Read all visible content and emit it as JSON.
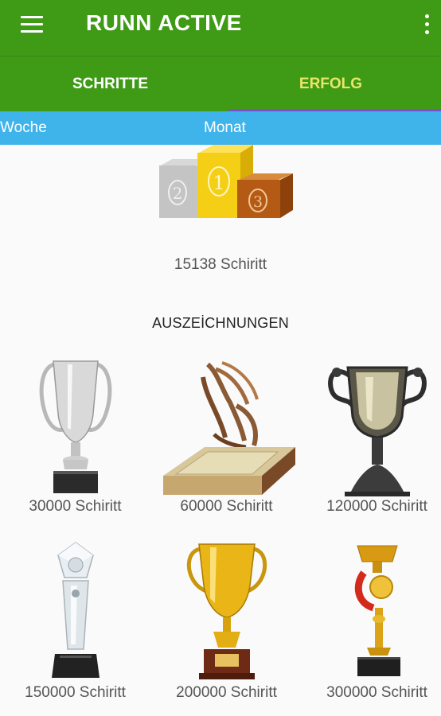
{
  "app_bar": {
    "title": "RUNN ACTIVE",
    "menu_icon": "hamburger-menu-icon",
    "overflow_icon": "more-vert-icon"
  },
  "tabs": [
    {
      "label": "SCHRITTE",
      "selected": false
    },
    {
      "label": "ERFOLG",
      "selected": true
    }
  ],
  "subtabs": [
    {
      "label": "Woche"
    },
    {
      "label": "Monat"
    }
  ],
  "podium": {
    "icon": "podium-icon",
    "places": [
      "2",
      "1",
      "3"
    ]
  },
  "current_steps": "15138 Schiritt",
  "awards": {
    "title": "AUSZEİCHNUNGEN",
    "items": [
      {
        "label": "30000 Schiritt",
        "icon": "silver-cup-trophy-icon"
      },
      {
        "label": "60000 Schiritt",
        "icon": "bronze-wing-award-icon"
      },
      {
        "label": "120000 Schiritt",
        "icon": "dark-dragon-cup-trophy-icon"
      },
      {
        "label": "150000 Schiritt",
        "icon": "crystal-trophy-icon"
      },
      {
        "label": "200000 Schiritt",
        "icon": "gold-cup-trophy-icon"
      },
      {
        "label": "300000 Schiritt",
        "icon": "gold-ribbon-trophy-icon"
      }
    ]
  },
  "colors": {
    "app_bar": "#3f9a16",
    "subtab_bar": "#3fb4ea",
    "active_tab_text": "#e8e66a",
    "tab_indicator": "#7b4fd0"
  }
}
